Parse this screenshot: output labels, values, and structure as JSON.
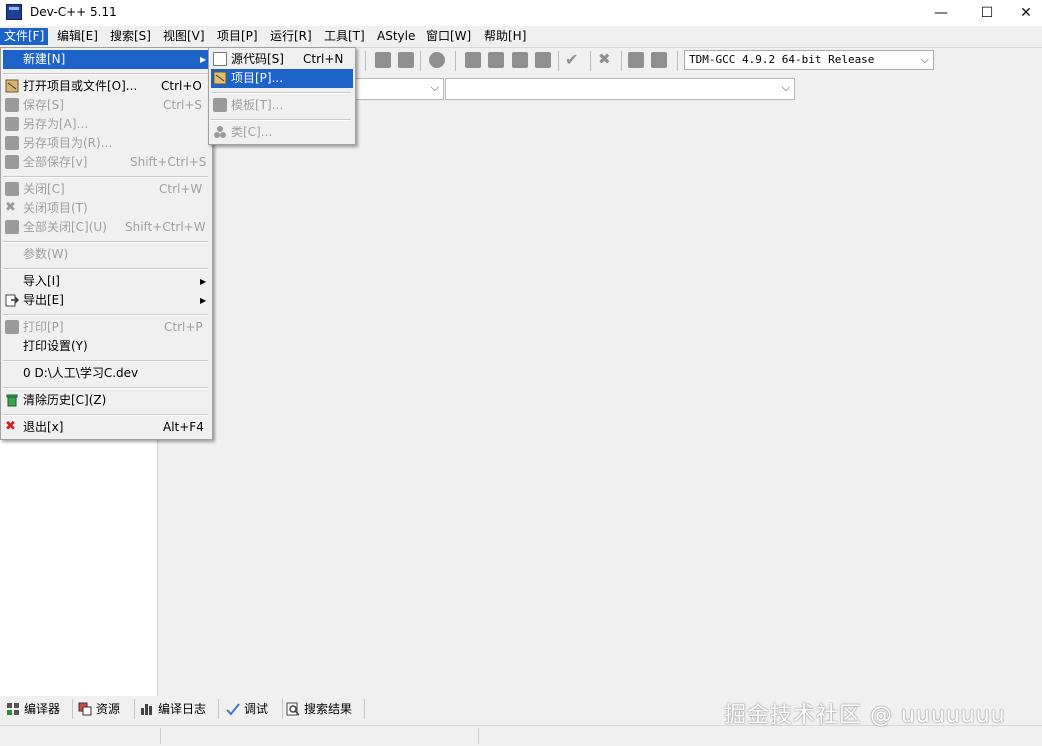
{
  "window": {
    "title": "Dev-C++ 5.11",
    "minimize": "—",
    "maximize": "☐",
    "close": "✕"
  },
  "menubar": [
    "文件[F]",
    "编辑[E]",
    "搜索[S]",
    "视图[V]",
    "项目[P]",
    "运行[R]",
    "工具[T]",
    "AStyle",
    "窗口[W]",
    "帮助[H]"
  ],
  "compiler": "TDM-GCC 4.9.2 64-bit Release",
  "file_menu": {
    "new": "新建[N]",
    "open": "打开项目或文件[O]...",
    "open_sc": "Ctrl+O",
    "save": "保存[S]",
    "save_sc": "Ctrl+S",
    "save_as": "另存为[A]...",
    "save_project_as": "另存项目为(R)...",
    "save_all": "全部保存[v]",
    "save_all_sc": "Shift+Ctrl+S",
    "close": "关闭[C]",
    "close_sc": "Ctrl+W",
    "close_project": "关闭项目(T)",
    "close_all": "全部关闭[C](U)",
    "close_all_sc": "Shift+Ctrl+W",
    "params": "参数(W)",
    "import": "导入[I]",
    "export": "导出[E]",
    "print": "打印[P]",
    "print_sc": "Ctrl+P",
    "print_setup": "打印设置(Y)",
    "recent": "0 D:\\人工\\学习C.dev",
    "clear_history": "清除历史[C](Z)",
    "exit": "退出[x]",
    "exit_sc": "Alt+F4"
  },
  "new_submenu": {
    "source": "源代码[S]",
    "source_sc": "Ctrl+N",
    "project": "项目[P]...",
    "template": "模板[T]...",
    "class": "类[C]..."
  },
  "bottom_tabs": [
    "编译器",
    "资源",
    "编译日志",
    "调试",
    "搜索结果"
  ],
  "watermark": "掘金技术社区 @ uuuuuuu"
}
